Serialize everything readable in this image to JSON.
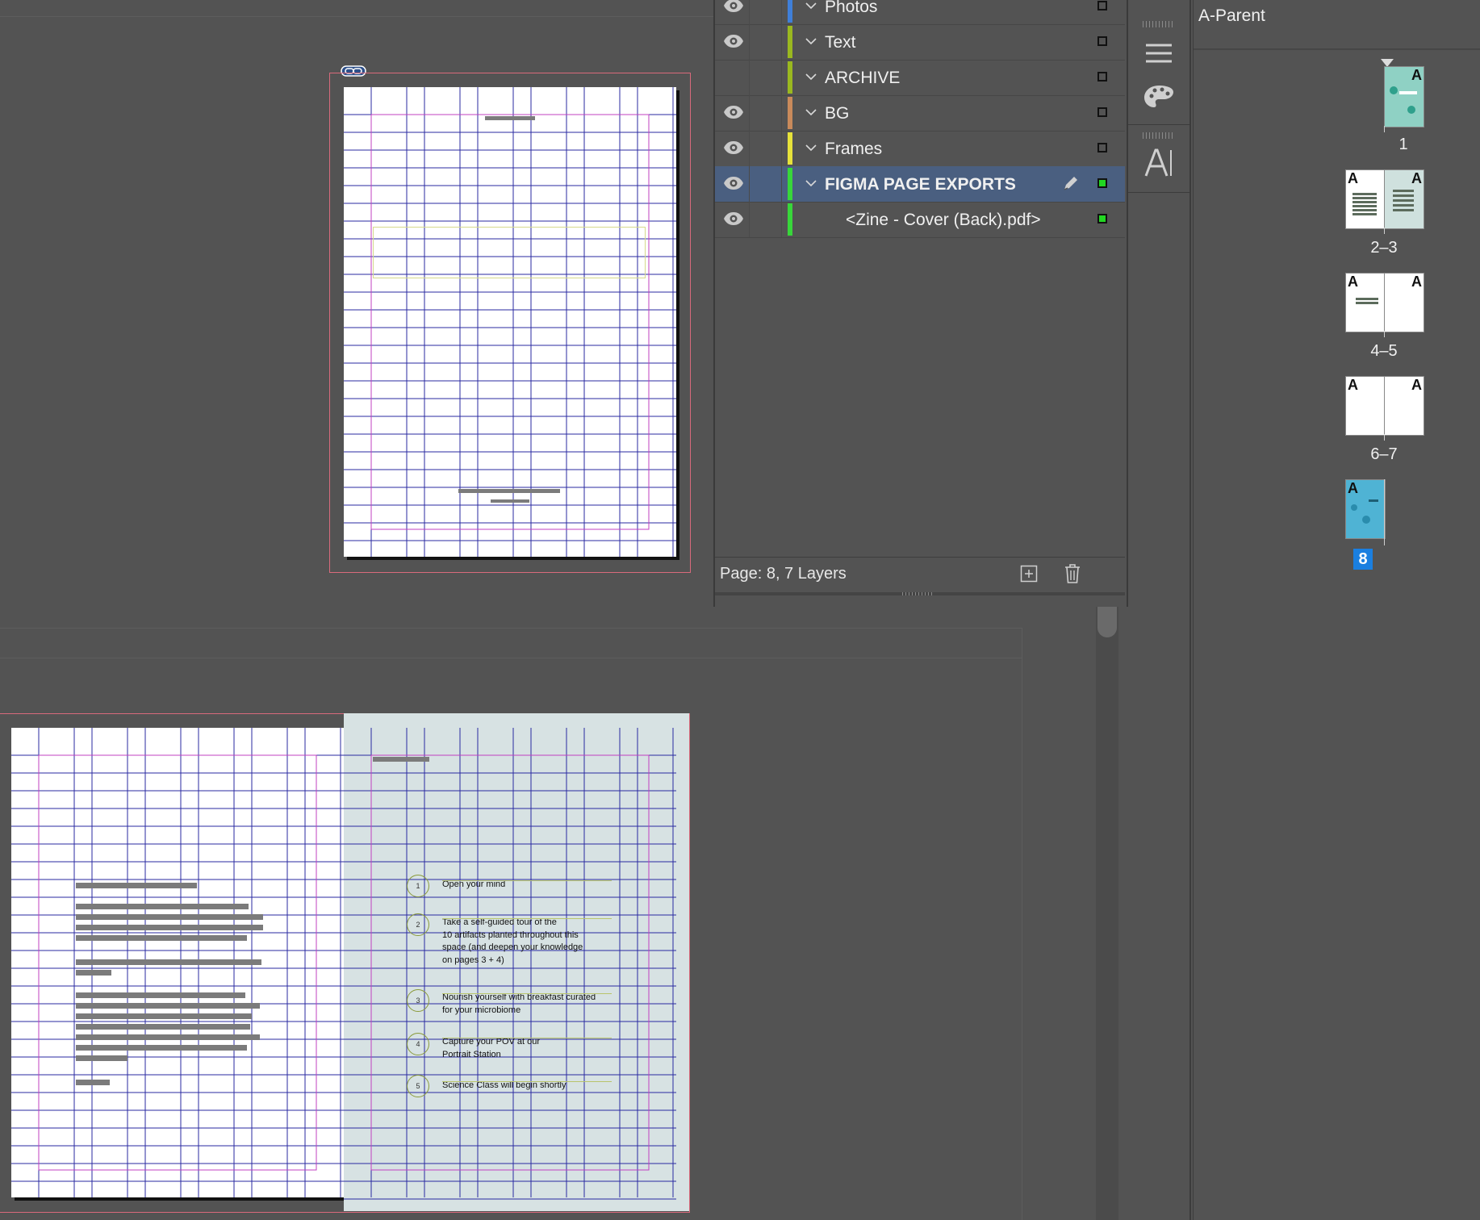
{
  "layers_panel": {
    "layers": [
      {
        "name": "Photos",
        "color": "#3f7fd9",
        "visible": true
      },
      {
        "name": "Text",
        "color": "#9ab81f",
        "visible": true
      },
      {
        "name": "ARCHIVE",
        "color": "#9ab81f",
        "visible": false
      },
      {
        "name": "BG",
        "color": "#c98a5b",
        "visible": true
      },
      {
        "name": "Frames",
        "color": "#e6e23a",
        "visible": true
      },
      {
        "name": "FIGMA PAGE EXPORTS",
        "color": "#38d63a",
        "visible": true,
        "selected": true
      },
      {
        "name": "<Zine - Cover (Back).pdf>",
        "color": "#38d63a",
        "visible": true,
        "child": true
      }
    ],
    "footer": "Page: 8, 7 Layers"
  },
  "pages_panel": {
    "parent_label": "A-Parent",
    "page_labels": [
      "1",
      "2–3",
      "4–5",
      "6–7",
      "8"
    ],
    "parent_marker": "A",
    "selected_page": "8"
  },
  "spread_steps": [
    {
      "num": "1",
      "text": "Open your mind"
    },
    {
      "num": "2",
      "text": "Take a self-guided tour of the\n10 artifacts planted throughout this\nspace (and deepen your knowledge\non pages 3 + 4)"
    },
    {
      "num": "3",
      "text": "Nourish yourself with breakfast curated\nfor your microbiome"
    },
    {
      "num": "4",
      "text": "Capture your POV at our\nPortrait Station"
    },
    {
      "num": "5",
      "text": "Science Class will begin shortly"
    }
  ],
  "colors": {
    "selection_row": "#4a5f80",
    "page_badge": "#1a7fe0",
    "grid_blue": "#2a2aa0",
    "margin_magenta": "#c040c0",
    "spread_right_bg": "#d7e2e3"
  }
}
